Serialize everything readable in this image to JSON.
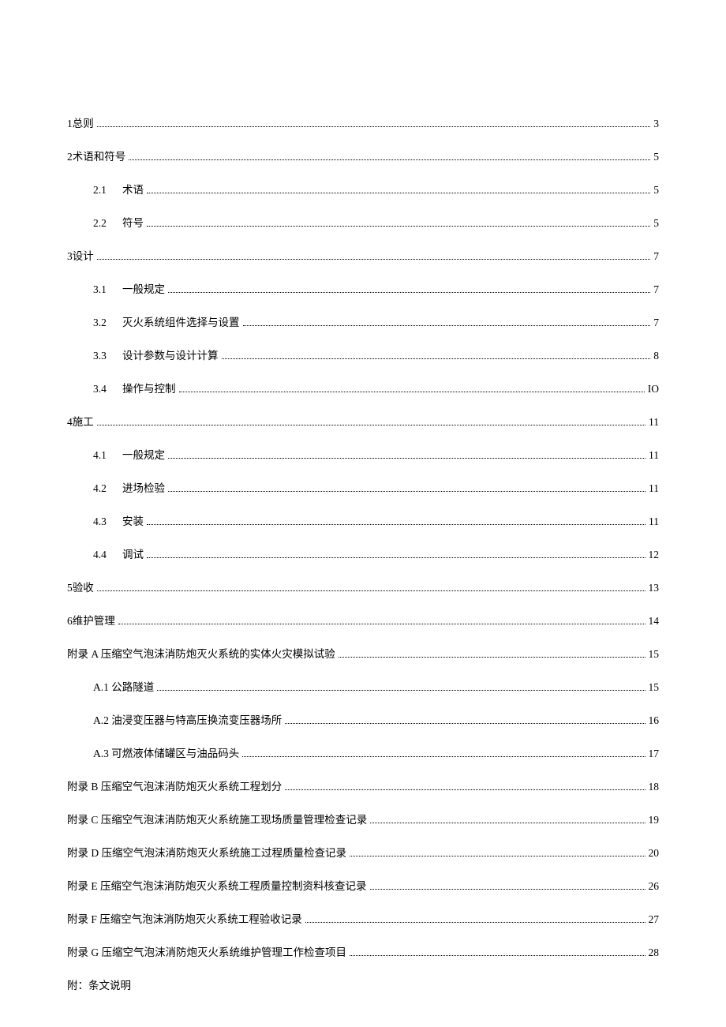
{
  "toc": [
    {
      "level": 1,
      "num": "1",
      "label": "总则",
      "page": "3"
    },
    {
      "level": 1,
      "num": "2",
      "label": "术语和符号",
      "page": "5"
    },
    {
      "level": 2,
      "num": "2.1",
      "label": "术语",
      "page": "5"
    },
    {
      "level": 2,
      "num": "2.2",
      "label": "符号",
      "page": "5"
    },
    {
      "level": 1,
      "num": "3",
      "label": "设计",
      "page": "7"
    },
    {
      "level": 2,
      "num": "3.1",
      "label": "一般规定",
      "page": "7"
    },
    {
      "level": 2,
      "num": "3.2",
      "label": "灭火系统组件选择与设置",
      "page": "7"
    },
    {
      "level": 2,
      "num": "3.3",
      "label": "设计参数与设计计算",
      "page": "8"
    },
    {
      "level": 2,
      "num": "3.4",
      "label": "操作与控制",
      "page": "IO"
    },
    {
      "level": 1,
      "num": "4",
      "label": "施工",
      "page": "11"
    },
    {
      "level": 2,
      "num": "4.1",
      "label": "一般规定",
      "page": "11"
    },
    {
      "level": 2,
      "num": "4.2",
      "label": "进场检验",
      "page": "11"
    },
    {
      "level": 2,
      "num": "4.3",
      "label": "安装",
      "page": "11"
    },
    {
      "level": 2,
      "num": "4.4",
      "label": "调试",
      "page": "12"
    },
    {
      "level": 1,
      "num": "5",
      "label": "验收",
      "page": "13"
    },
    {
      "level": 1,
      "num": "6",
      "label": "维护管理",
      "page": "14"
    },
    {
      "level": 1,
      "num": "",
      "label": "附录 A 压缩空气泡沫消防炮灭火系统的实体火灾模拟试验",
      "page": "15"
    },
    {
      "level": 2,
      "num": "",
      "label": "A.1 公路隧道",
      "page": "15"
    },
    {
      "level": 2,
      "num": "",
      "label": "A.2 油浸变压器与特高压换流变压器场所",
      "page": "16"
    },
    {
      "level": 2,
      "num": "",
      "label": "A.3 可燃液体储罐区与油品码头",
      "page": "17"
    },
    {
      "level": 1,
      "num": "",
      "label": "附录 B 压缩空气泡沫消防炮灭火系统工程划分",
      "page": "18"
    },
    {
      "level": 1,
      "num": "",
      "label": "附录 C 压缩空气泡沫消防炮灭火系统施工现场质量管理检查记录",
      "page": "19"
    },
    {
      "level": 1,
      "num": "",
      "label": "附录 D 压缩空气泡沫消防炮灭火系统施工过程质量检查记录",
      "page": "20"
    },
    {
      "level": 1,
      "num": "",
      "label": "附录 E 压缩空气泡沫消防炮灭火系统工程质量控制资料核查记录",
      "page": "26"
    },
    {
      "level": 1,
      "num": "",
      "label": "附录 F 压缩空气泡沫消防炮灭火系统工程验收记录",
      "page": "27"
    },
    {
      "level": 1,
      "num": "",
      "label": "附录 G 压缩空气泡沫消防炮灭火系统维护管理工作检查项目",
      "page": "28"
    }
  ],
  "footer_line": "附：条文说明"
}
